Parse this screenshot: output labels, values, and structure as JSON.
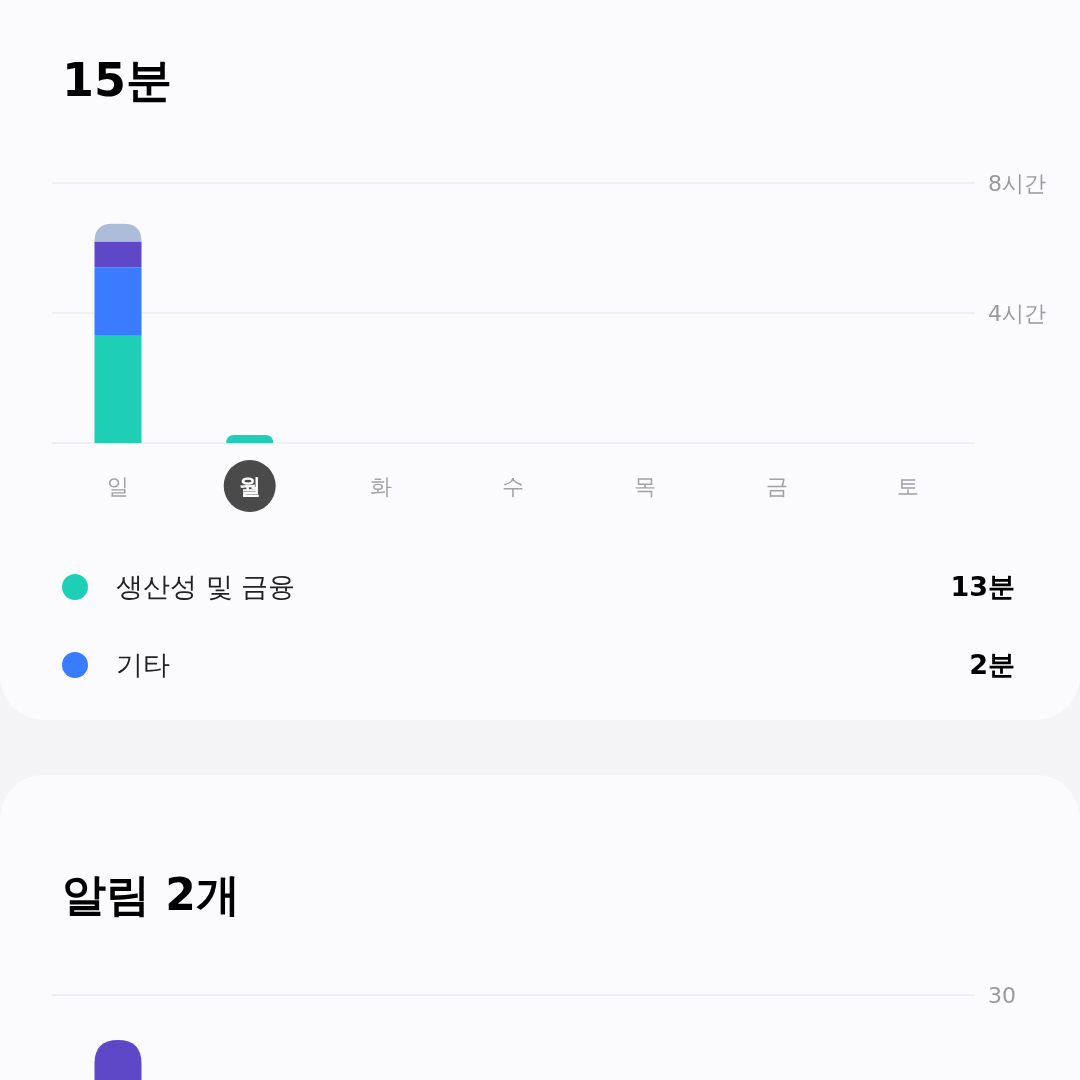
{
  "usage_card": {
    "title": "15분",
    "chart_data": {
      "type": "bar",
      "stacked": true,
      "categories": [
        "일",
        "월",
        "화",
        "수",
        "목",
        "금",
        "토"
      ],
      "ylim": [
        0,
        8
      ],
      "yticks": [
        {
          "value": 4,
          "label": "4시간"
        },
        {
          "value": 8,
          "label": "8시간"
        }
      ],
      "series": [
        {
          "color": "#1ecfb6",
          "values": [
            3.3,
            0.25,
            0,
            0,
            0,
            0,
            0
          ]
        },
        {
          "color": "#3a7bff",
          "values": [
            2.1,
            0,
            0,
            0,
            0,
            0,
            0
          ]
        },
        {
          "color": "#5e48c8",
          "values": [
            0.8,
            0,
            0,
            0,
            0,
            0,
            0
          ]
        },
        {
          "color": "#adbcd8",
          "values": [
            0.55,
            0,
            0,
            0,
            0,
            0,
            0
          ]
        }
      ]
    },
    "days": [
      {
        "selected": false
      },
      {
        "selected": true
      },
      {
        "selected": false
      },
      {
        "selected": false
      },
      {
        "selected": false
      },
      {
        "selected": false
      },
      {
        "selected": false
      }
    ],
    "legend": [
      {
        "name": "생산성 및 금융",
        "value": "13분",
        "color": "#1ecfb6"
      },
      {
        "name": "기타",
        "value": "2분",
        "color": "#3a7bff"
      }
    ]
  },
  "notifications_card": {
    "title": "알림 2개",
    "axis_label": "30"
  }
}
